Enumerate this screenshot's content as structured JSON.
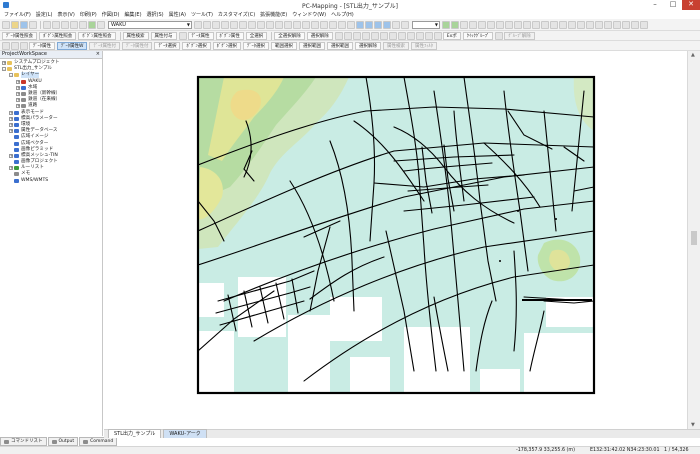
{
  "window": {
    "title": "PC-Mapping - [STL出力_サンプル]",
    "minimize": "–",
    "maximize": "□",
    "close": "✕"
  },
  "menu": [
    "ファイル(F)",
    "設定(L)",
    "表示(V)",
    "印刷(P)",
    "作図(D)",
    "編集(E)",
    "選択(S)",
    "属性(A)",
    "ツール(T)",
    "カスタマイズ(C)",
    "拡張機能(E)",
    "ウィンドウ(W)",
    "ヘルプ(H)"
  ],
  "toolbar1": {
    "layer_combo": "WAKU",
    "zoom_combo": ""
  },
  "toolbar2": [
    "ﾃﾞｰﾀ属性照会",
    "ﾎﾞｸﾞﾝ属性照会",
    "ﾎﾞｸﾞﾝ属性照会",
    "属性検索",
    "属性付与",
    "ﾃﾞｰﾀ属性",
    "ﾎﾞｸﾞﾝ属性",
    "全選択",
    "全選択解除",
    "選択解除",
    "Exポ",
    "ｸｲｯｸｸﾞﾙｰﾌﾟ",
    "ｸﾞﾙｰﾌﾟ解除"
  ],
  "toolbar3": [
    {
      "label": "ﾃﾞｰﾀ属性",
      "state": "normal"
    },
    {
      "label": "ﾃﾞｰﾀ属性W",
      "state": "selected"
    },
    {
      "label": "ﾃﾞｰﾀ属性付",
      "state": "disabled"
    },
    {
      "label": "ﾃﾞｰﾀ属性付",
      "state": "disabled"
    },
    {
      "label": "ﾃﾞｰﾀ選択",
      "state": "normal"
    },
    {
      "label": "ﾎﾞｸﾞﾝ選択",
      "state": "normal"
    },
    {
      "label": "ﾎﾞｸﾞﾝ選択",
      "state": "normal"
    },
    {
      "label": "ﾃﾞｰﾀ選択",
      "state": "normal"
    },
    {
      "label": "範囲選択",
      "state": "normal"
    },
    {
      "label": "選択範囲",
      "state": "normal"
    },
    {
      "label": "選択範囲",
      "state": "normal"
    },
    {
      "label": "選択解除",
      "state": "normal"
    },
    {
      "label": "属性検索",
      "state": "disabled"
    },
    {
      "label": "属性ﾌｨﾙﾀ",
      "state": "disabled"
    }
  ],
  "panel": {
    "title": "ProjectWorkSpace",
    "close": "×",
    "tree": [
      {
        "label": "システムプロジェクト",
        "level": 0,
        "exp": "+",
        "icon": "folder"
      },
      {
        "label": "STL出力_サンプル",
        "level": 0,
        "exp": "-",
        "icon": "folder"
      },
      {
        "label": "レイヤー",
        "level": 1,
        "exp": "-",
        "icon": "folder",
        "highlight": true
      },
      {
        "label": "WAKU",
        "level": 2,
        "exp": "+",
        "icon": "red"
      },
      {
        "label": "水域",
        "level": 2,
        "exp": "+",
        "icon": "blue"
      },
      {
        "label": "鉄道（新幹線）",
        "level": 2,
        "exp": "+",
        "icon": "gray"
      },
      {
        "label": "鉄道（在来線）",
        "level": 2,
        "exp": "+",
        "icon": "gray"
      },
      {
        "label": "道路",
        "level": 2,
        "exp": "+",
        "icon": "gray"
      },
      {
        "label": "表示モード",
        "level": 1,
        "exp": "+",
        "icon": "blue"
      },
      {
        "label": "標高パラメーター",
        "level": 1,
        "exp": "+",
        "icon": "blue"
      },
      {
        "label": "環境",
        "level": 1,
        "exp": "+",
        "icon": "blue"
      },
      {
        "label": "属性データベース",
        "level": 1,
        "exp": "+",
        "icon": "blue"
      },
      {
        "label": "広域イメージ",
        "level": 1,
        "exp": "",
        "icon": "blue"
      },
      {
        "label": "広域ベクター",
        "level": 1,
        "exp": "",
        "icon": "blue"
      },
      {
        "label": "画像ピラミッド",
        "level": 1,
        "exp": "",
        "icon": "blue"
      },
      {
        "label": "標高メッシュ-TIN",
        "level": 1,
        "exp": "+",
        "icon": "blue"
      },
      {
        "label": "画像プロジェクト",
        "level": 1,
        "exp": "",
        "icon": "blue"
      },
      {
        "label": "ルーリスト",
        "level": 1,
        "exp": "+",
        "icon": "green"
      },
      {
        "label": "メモ",
        "level": 1,
        "exp": "",
        "icon": "gray"
      },
      {
        "label": "WMS/WMTS",
        "level": 1,
        "exp": "",
        "icon": "blue"
      }
    ]
  },
  "panel_tabs": [
    "コマンドリスト",
    "Output",
    "Command"
  ],
  "doc_tabs": [
    {
      "label": "STL出力_サンプル",
      "state": "active"
    },
    {
      "label": "WAKU-アーク",
      "state": "blue"
    }
  ],
  "status": {
    "coords": "-178,357.9 33,255.6 (m)",
    "latlon": "E132:31:42.02 N34:23:30.01",
    "scale": "1 / 54,326"
  },
  "colors": {
    "water": "#c9ece4",
    "road": "#000000",
    "frame": "#000000",
    "panel_header": "#e9eef5"
  }
}
